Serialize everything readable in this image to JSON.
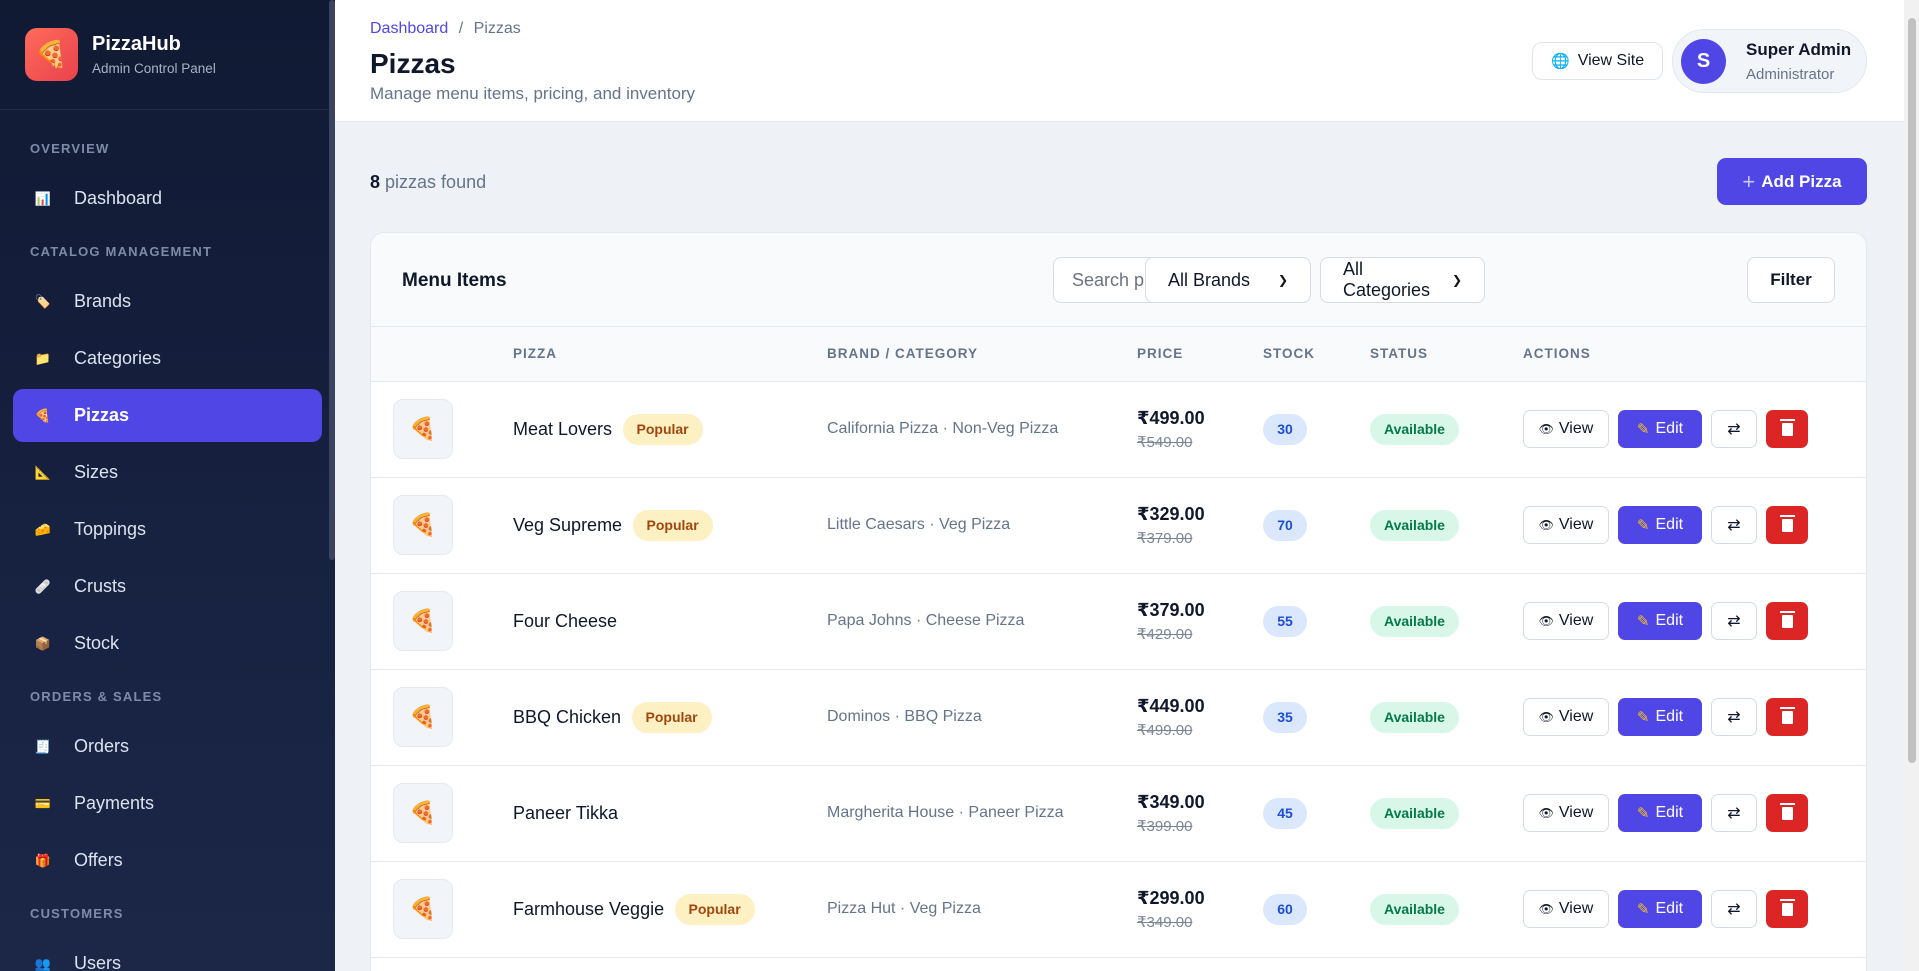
{
  "app": {
    "name": "PizzaHub",
    "subtitle": "Admin Control Panel",
    "logo_icon": "🍕"
  },
  "sidebar": {
    "sections": [
      {
        "title": "OVERVIEW",
        "items": [
          {
            "label": "Dashboard",
            "icon": "chart-icon",
            "glyph": "📊"
          }
        ]
      },
      {
        "title": "CATALOG MANAGEMENT",
        "items": [
          {
            "label": "Brands",
            "icon": "tag-icon",
            "glyph": "🏷️"
          },
          {
            "label": "Categories",
            "icon": "folder-icon",
            "glyph": "📁"
          },
          {
            "label": "Pizzas",
            "icon": "pizza-icon",
            "glyph": "🍕",
            "active": true
          },
          {
            "label": "Sizes",
            "icon": "ruler-icon",
            "glyph": "📐"
          },
          {
            "label": "Toppings",
            "icon": "cheese-icon",
            "glyph": "🧀"
          },
          {
            "label": "Crusts",
            "icon": "bandage-icon",
            "glyph": "🩹"
          },
          {
            "label": "Stock",
            "icon": "package-icon",
            "glyph": "📦"
          }
        ]
      },
      {
        "title": "ORDERS & SALES",
        "items": [
          {
            "label": "Orders",
            "icon": "receipt-icon",
            "glyph": "🧾"
          },
          {
            "label": "Payments",
            "icon": "card-icon",
            "glyph": "💳"
          },
          {
            "label": "Offers",
            "icon": "gift-icon",
            "glyph": "🎁"
          }
        ]
      },
      {
        "title": "CUSTOMERS",
        "items": [
          {
            "label": "Users",
            "icon": "users-icon",
            "glyph": "👥"
          }
        ]
      }
    ]
  },
  "header": {
    "breadcrumb_root": "Dashboard",
    "breadcrumb_sep": "/",
    "breadcrumb_current": "Pizzas",
    "title": "Pizzas",
    "subtitle": "Manage menu items, pricing, and inventory",
    "view_site_label": "View Site",
    "user": {
      "initial": "S",
      "name": "Super Admin",
      "role": "Administrator"
    }
  },
  "summary": {
    "count": "8",
    "count_suffix": "pizzas found",
    "add_button": "Add Pizza"
  },
  "card": {
    "title": "Menu Items",
    "search_placeholder": "Search pizzas...",
    "brand_filter": "All Brands",
    "category_filter": "All Categories",
    "filter_button": "Filter"
  },
  "table": {
    "columns": [
      "",
      "PIZZA",
      "BRAND / CATEGORY",
      "PRICE",
      "STOCK",
      "STATUS",
      "ACTIONS"
    ],
    "action_labels": {
      "view": "View",
      "edit": "Edit"
    },
    "rows": [
      {
        "name": "Meat Lovers",
        "popular": true,
        "brand": "California Pizza · Non-Veg Pizza",
        "price": "₹499.00",
        "old_price": "₹549.00",
        "stock": "30",
        "status": "Available"
      },
      {
        "name": "Veg Supreme",
        "popular": true,
        "brand": "Little Caesars · Veg Pizza",
        "price": "₹329.00",
        "old_price": "₹379.00",
        "stock": "70",
        "status": "Available"
      },
      {
        "name": "Four Cheese",
        "popular": false,
        "brand": "Papa Johns · Cheese Pizza",
        "price": "₹379.00",
        "old_price": "₹429.00",
        "stock": "55",
        "status": "Available"
      },
      {
        "name": "BBQ Chicken",
        "popular": true,
        "brand": "Dominos · BBQ Pizza",
        "price": "₹449.00",
        "old_price": "₹499.00",
        "stock": "35",
        "status": "Available"
      },
      {
        "name": "Paneer Tikka",
        "popular": false,
        "brand": "Margherita House · Paneer Pizza",
        "price": "₹349.00",
        "old_price": "₹399.00",
        "stock": "45",
        "status": "Available"
      },
      {
        "name": "Farmhouse Veggie",
        "popular": true,
        "brand": "Pizza Hut · Veg Pizza",
        "price": "₹299.00",
        "old_price": "₹349.00",
        "stock": "60",
        "status": "Available"
      }
    ],
    "popular_label": "Popular"
  },
  "colors": {
    "primary": "#4f46e5",
    "danger": "#dc2626",
    "sidebar_bg": "#101a33",
    "popular_bg": "#fdf0c2",
    "available_bg": "#d9f7e8"
  }
}
